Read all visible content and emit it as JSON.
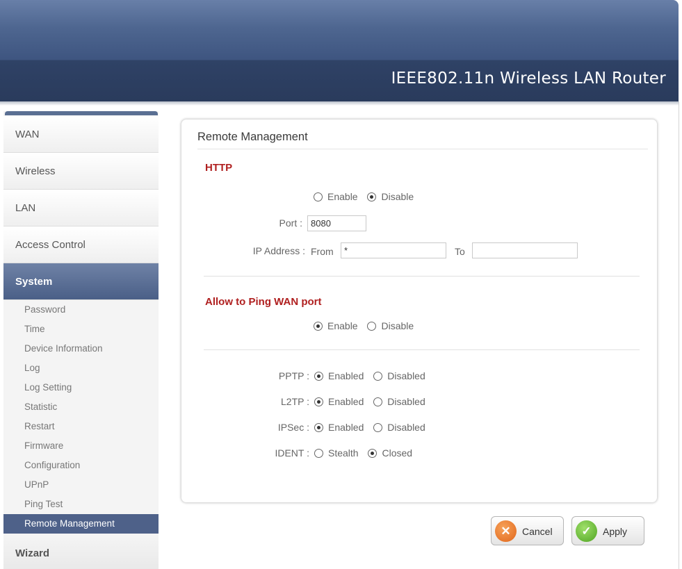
{
  "header": {
    "title": "IEEE802.11n Wireless LAN Router"
  },
  "sidebar": {
    "items": [
      {
        "label": "WAN"
      },
      {
        "label": "Wireless"
      },
      {
        "label": "LAN"
      },
      {
        "label": "Access Control"
      },
      {
        "label": "System",
        "active": true
      }
    ],
    "submenu": [
      {
        "label": "Password"
      },
      {
        "label": "Time"
      },
      {
        "label": "Device Information"
      },
      {
        "label": "Log"
      },
      {
        "label": "Log Setting"
      },
      {
        "label": "Statistic"
      },
      {
        "label": "Restart"
      },
      {
        "label": "Firmware"
      },
      {
        "label": "Configuration"
      },
      {
        "label": "UPnP"
      },
      {
        "label": "Ping Test"
      },
      {
        "label": "Remote Management",
        "active": true
      }
    ],
    "wizard_label": "Wizard"
  },
  "panel": {
    "title": "Remote Management",
    "http": {
      "section_title": "HTTP",
      "enable_label": "Enable",
      "disable_label": "Disable",
      "selected": "Disable",
      "port_label": "Port :",
      "port_value": "8080",
      "ip_label": "IP Address :",
      "from_label": "From",
      "from_value": "*",
      "to_label": "To",
      "to_value": ""
    },
    "ping": {
      "section_title": "Allow to Ping WAN port",
      "enable_label": "Enable",
      "disable_label": "Disable",
      "selected": "Enable"
    },
    "pptp": {
      "label": "PPTP :",
      "opt1": "Enabled",
      "opt2": "Disabled",
      "selected": "Enabled"
    },
    "l2tp": {
      "label": "L2TP :",
      "opt1": "Enabled",
      "opt2": "Disabled",
      "selected": "Enabled"
    },
    "ipsec": {
      "label": "IPSec :",
      "opt1": "Enabled",
      "opt2": "Disabled",
      "selected": "Enabled"
    },
    "ident": {
      "label": "IDENT :",
      "opt1": "Stealth",
      "opt2": "Closed",
      "selected": "Closed"
    }
  },
  "buttons": {
    "cancel_label": "Cancel",
    "cancel_icon": "x-icon",
    "apply_label": "Apply",
    "apply_icon": "checkmark-icon"
  },
  "colors": {
    "header": "#3e5580",
    "section_title": "#b02020",
    "nav_active": "#5a6f93",
    "submenu_active": "#4e6189"
  }
}
